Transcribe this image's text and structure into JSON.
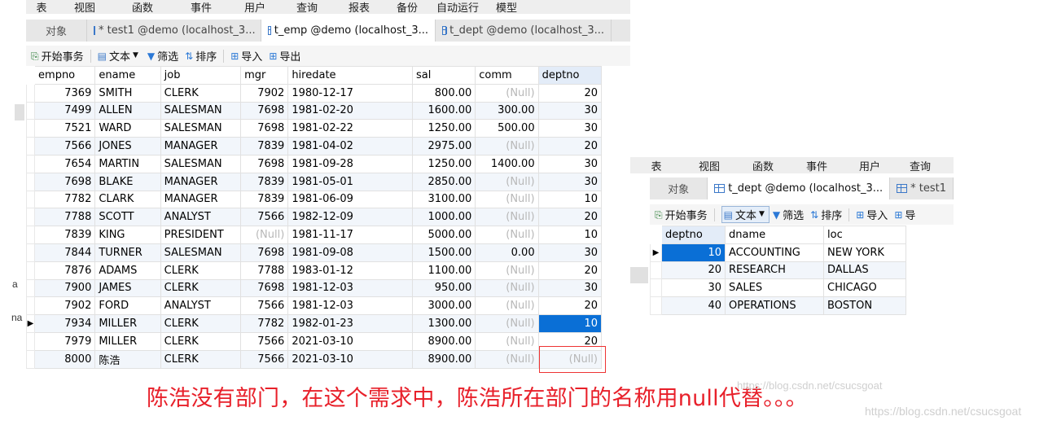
{
  "left_window": {
    "menu": [
      "表",
      "视图",
      "函数",
      "事件",
      "用户",
      "查询",
      "报表",
      "备份",
      "自动运行",
      "模型"
    ],
    "tabs": {
      "object": "对象",
      "items": [
        "* test1 @demo (localhost_3...",
        "t_emp @demo (localhost_3...",
        "t_dept @demo (localhost_3..."
      ]
    },
    "toolbar": {
      "begin_tx": "开始事务",
      "text": "文本",
      "filter": "筛选",
      "sort": "排序",
      "import": "导入",
      "export": "导出"
    },
    "columns": [
      "empno",
      "ename",
      "job",
      "mgr",
      "hiredate",
      "sal",
      "comm",
      "deptno"
    ],
    "rows": [
      [
        "7369",
        "SMITH",
        "CLERK",
        "7902",
        "1980-12-17",
        "800.00",
        "(Null)",
        "20"
      ],
      [
        "7499",
        "ALLEN",
        "SALESMAN",
        "7698",
        "1981-02-20",
        "1600.00",
        "300.00",
        "30"
      ],
      [
        "7521",
        "WARD",
        "SALESMAN",
        "7698",
        "1981-02-22",
        "1250.00",
        "500.00",
        "30"
      ],
      [
        "7566",
        "JONES",
        "MANAGER",
        "7839",
        "1981-04-02",
        "2975.00",
        "(Null)",
        "20"
      ],
      [
        "7654",
        "MARTIN",
        "SALESMAN",
        "7698",
        "1981-09-28",
        "1250.00",
        "1400.00",
        "30"
      ],
      [
        "7698",
        "BLAKE",
        "MANAGER",
        "7839",
        "1981-05-01",
        "2850.00",
        "(Null)",
        "30"
      ],
      [
        "7782",
        "CLARK",
        "MANAGER",
        "7839",
        "1981-06-09",
        "3100.00",
        "(Null)",
        "10"
      ],
      [
        "7788",
        "SCOTT",
        "ANALYST",
        "7566",
        "1982-12-09",
        "1000.00",
        "(Null)",
        "20"
      ],
      [
        "7839",
        "KING",
        "PRESIDENT",
        "(Null)",
        "1981-11-17",
        "5000.00",
        "(Null)",
        "10"
      ],
      [
        "7844",
        "TURNER",
        "SALESMAN",
        "7698",
        "1981-09-08",
        "1500.00",
        "0.00",
        "30"
      ],
      [
        "7876",
        "ADAMS",
        "CLERK",
        "7788",
        "1983-01-12",
        "1100.00",
        "(Null)",
        "20"
      ],
      [
        "7900",
        "JAMES",
        "CLERK",
        "7698",
        "1981-12-03",
        "950.00",
        "(Null)",
        "30"
      ],
      [
        "7902",
        "FORD",
        "ANALYST",
        "7566",
        "1981-12-03",
        "3000.00",
        "(Null)",
        "20"
      ],
      [
        "7934",
        "MILLER",
        "CLERK",
        "7782",
        "1982-01-23",
        "1300.00",
        "(Null)",
        "10"
      ],
      [
        "7979",
        "MILLER",
        "CLERK",
        "7566",
        "2021-03-10",
        "8900.00",
        "(Null)",
        "20"
      ],
      [
        "8000",
        "陈浩",
        "CLERK",
        "7566",
        "2021-03-10",
        "8900.00",
        "(Null)",
        "(Null)"
      ]
    ],
    "selected_row": 13,
    "side_fragments": [
      "a",
      "na"
    ]
  },
  "right_window": {
    "menu": [
      "表",
      "视图",
      "函数",
      "事件",
      "用户",
      "查询"
    ],
    "tabs": {
      "object": "对象",
      "items": [
        "t_dept @demo (localhost_3...",
        "* test1"
      ]
    },
    "toolbar": {
      "begin_tx": "开始事务",
      "text": "文本",
      "filter": "筛选",
      "sort": "排序",
      "import": "导入",
      "export": "导"
    },
    "columns": [
      "deptno",
      "dname",
      "loc"
    ],
    "rows": [
      [
        "10",
        "ACCOUNTING",
        "NEW YORK"
      ],
      [
        "20",
        "RESEARCH",
        "DALLAS"
      ],
      [
        "30",
        "SALES",
        "CHICAGO"
      ],
      [
        "40",
        "OPERATIONS",
        "BOSTON"
      ]
    ],
    "selected_row": 0
  },
  "caption": "陈浩没有部门，在这个需求中，陈浩所在部门的名称用null代替。。。",
  "watermarks": [
    "https://blog.csdn.net/csucsgoat",
    "https://blog.csdn.net/csucsgoat"
  ],
  "colors": {
    "selection": "#0a6fd6",
    "null_text": "#b8b8b8",
    "caption": "#e8202a",
    "highlight_box": "#e33333"
  }
}
